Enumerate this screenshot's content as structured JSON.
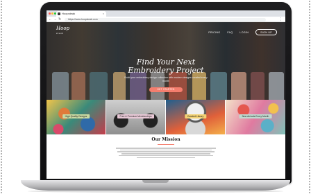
{
  "browser": {
    "tab_title": "Hoopsteak",
    "tab_close": "×",
    "url": "https://www.hoopsteak.com",
    "nav_back": "←",
    "nav_forward": "→",
    "nav_reload": "↻",
    "menu": "⋮"
  },
  "site": {
    "logo_text": "Hoop",
    "logo_sub": "steak",
    "nav": {
      "pricing": "PRICING",
      "faq": "FAQ",
      "login": "LOGIN",
      "signup": "SIGN UP"
    },
    "hero": {
      "title_line1": "Find Your Next",
      "title_line2": "Embroidery Project",
      "subtitle": "Build your embroidery design collection with modern designs curated every month",
      "cta": "GET STARTED"
    },
    "features": [
      {
        "label": "High Quality Designs"
      },
      {
        "label": "Free & Premium Memberships"
      },
      {
        "label": "Curated Library"
      },
      {
        "label": "New Arrivals Every Month"
      }
    ],
    "mission": {
      "title": "Our Mission"
    }
  },
  "colors": {
    "accent": "#f47e6e",
    "feature_label_bg": [
      "#c9d9a2",
      "#e8c8d6",
      "#f2d173",
      "#bfdbd0"
    ]
  }
}
